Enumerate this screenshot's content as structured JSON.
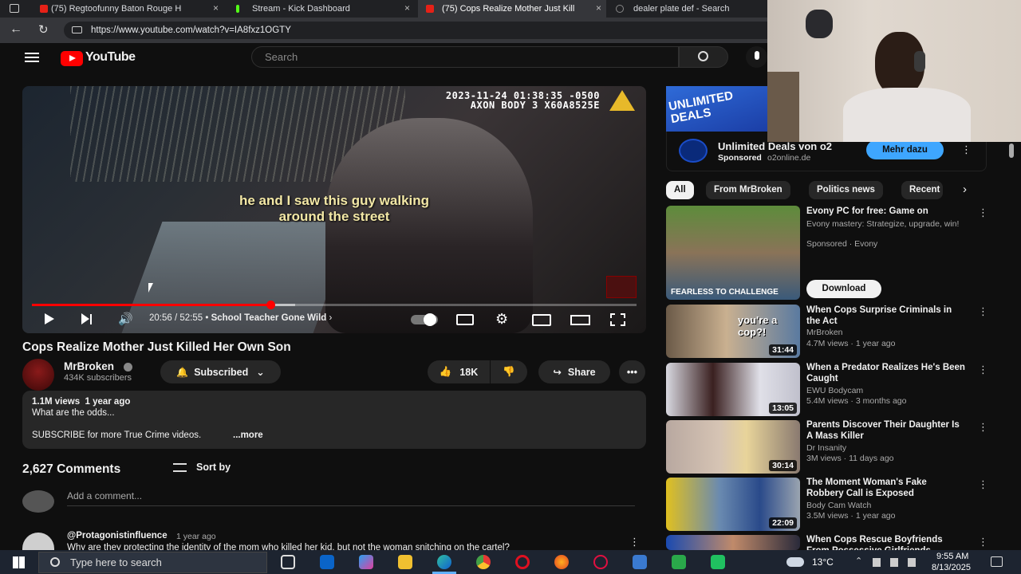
{
  "browser": {
    "tabs": [
      {
        "title": "(75) Regtoofunny Baton Rouge H",
        "close": "×"
      },
      {
        "title": "Stream - Kick Dashboard",
        "close": "×"
      },
      {
        "title": "(75) Cops Realize Mother Just Kill",
        "close": "×"
      },
      {
        "title": "dealer plate def - Search",
        "close": ""
      }
    ],
    "url": "https://www.youtube.com/watch?v=IA8fxz1OGTY"
  },
  "youtube": {
    "logo_text": "YouTube",
    "search_placeholder": "Search"
  },
  "video": {
    "timestamp_line1": "2023-11-24 01:38:35 -0500",
    "timestamp_line2": "AXON BODY 3 X60A8525E",
    "subtitle_line1": "he and I saw this guy walking",
    "subtitle_line2": "around the street",
    "time": "20:56 / 52:55",
    "chapter": "School Teacher Gone Wild",
    "progress_fraction": 0.395
  },
  "watch": {
    "title": "Cops Realize Mother Just Killed Her Own Son",
    "channel": "MrBroken",
    "subscribers": "434K subscribers",
    "subscribed_label": "Subscribed",
    "likes": "18K",
    "share_label": "Share",
    "description": {
      "stats": "1.1M views  1 year ago",
      "line1": "What are the odds...",
      "line2": "SUBSCRIBE for more True Crime videos.",
      "more": "...more"
    },
    "comments": {
      "count": "2,627 Comments",
      "sort_label": "Sort by",
      "add_placeholder": "Add a comment...",
      "first_author": "@Protagonistinfluence",
      "first_time": "1 year ago",
      "first_text": "Why are they protecting the identity of the mom who killed her kid, but not the woman snitching on the cartel?"
    }
  },
  "sidebar": {
    "ad": {
      "image_text": "UNLIMITED DEALS",
      "title": "Unlimited Deals von o2",
      "sponsored": "Sponsored",
      "domain": "o2online.de",
      "cta": "Mehr dazu"
    },
    "chips": [
      "All",
      "From MrBroken",
      "Politics news",
      "Recent"
    ],
    "items": [
      {
        "title": "Evony PC for free: Game on",
        "meta1": "Evony mastery: Strategize, upgrade, win!",
        "meta2": "Sponsored · Evony",
        "duration": "",
        "thumb_text": "FEARLESS TO CHALLENGE",
        "action": "Download"
      },
      {
        "title": "When Cops Surprise Criminals in the Act",
        "meta1": "MrBroken",
        "meta2": "4.7M views · 1 year ago",
        "duration": "31:44",
        "thumb_text": "you're a cop?!"
      },
      {
        "title": "When a Predator Realizes He's Been Caught",
        "meta1": "EWU Bodycam",
        "meta2": "5.4M views · 3 months ago",
        "duration": "13:05",
        "thumb_text": ""
      },
      {
        "title": "Parents Discover Their Daughter Is A Mass Killer",
        "meta1": "Dr Insanity",
        "meta2": "3M views · 11 days ago",
        "duration": "30:14",
        "thumb_text": ""
      },
      {
        "title": "The Moment Woman's Fake Robbery Call is Exposed",
        "meta1": "Body Cam Watch",
        "meta2": "3.5M views · 1 year ago",
        "duration": "22:09",
        "thumb_text": ""
      },
      {
        "title": "When Cops Rescue Boyfriends From Possessive Girlfriends",
        "meta1": "",
        "meta2": "",
        "duration": "",
        "thumb_text": ""
      }
    ]
  },
  "taskbar": {
    "search_placeholder": "Type here to search",
    "weather": "13°C",
    "time": "9:55 AM",
    "date": "8/13/2025"
  },
  "colors": {
    "accent": "#ff0000",
    "link": "#3ea6ff",
    "background": "#0f0f0f"
  }
}
